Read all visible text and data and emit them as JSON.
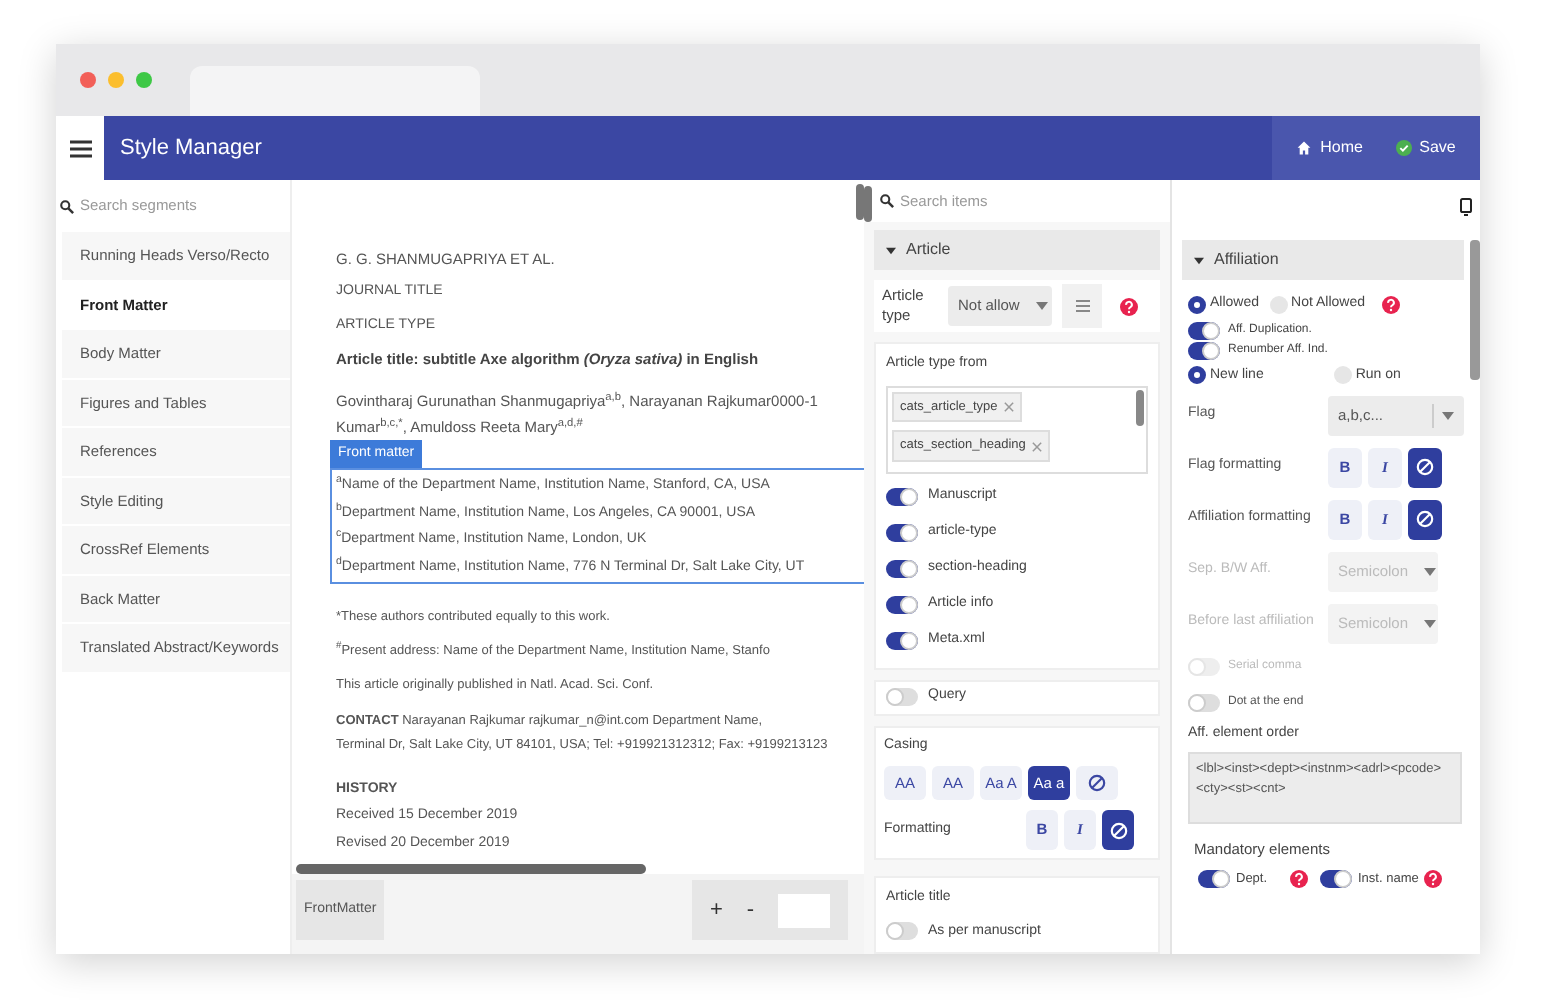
{
  "header": {
    "title": "Style Manager",
    "actions": [
      {
        "kind": "home",
        "label": "Home"
      },
      {
        "kind": "save",
        "label": "Save"
      }
    ]
  },
  "sidebar": {
    "placeholder": "Search segments",
    "items": [
      {
        "label": "Running Heads Verso/Recto",
        "selected": false
      },
      {
        "label": "Front Matter",
        "selected": true
      },
      {
        "label": "Body Matter",
        "selected": false
      },
      {
        "label": "Figures and Tables",
        "selected": false
      },
      {
        "label": "References",
        "selected": false
      },
      {
        "label": "Style Editing",
        "selected": false
      },
      {
        "label": "CrossRef Elements",
        "selected": false
      },
      {
        "label": "Back Matter",
        "selected": false
      },
      {
        "label": "Translated Abstract/Keywords",
        "selected": false
      }
    ]
  },
  "document": {
    "heads": [
      "G. G. SHANMUGAPRIYA ET AL.",
      "JOURNAL TITLE",
      "ARTICLE TYPE"
    ],
    "article_title": "Article title: subtitle Axe algorithm *(Oryza sativa)* in English",
    "authors": [
      "Govintharaj Gurunathan Shanmugapriya$^{a,b}$, Narayanan Rajkumar0000-1",
      "Kumar$^{b,c,*}$, Amuldoss Reeta Mary$^{a,d,#}$"
    ],
    "frame": {
      "label": "Front matter",
      "lines": [
        "$^{a}$Name of the Department Name, Institution Name, Stanford, CA, USA",
        "$^{b}$Department Name, Institution Name, Los Angeles, CA 90001, USA",
        "$^{c}$Department Name, Institution Name, London, UK",
        "$^{d}$Department Name, Institution Name, 776 N Terminal Dr, Salt Lake City, UT"
      ]
    },
    "notes": [
      "*These authors contributed equally to this work.",
      "$^{#}$Present address: Name of the Department Name, Institution Name, Stanfo",
      "This article originally published in Natl. Acad. Sci. Conf."
    ],
    "contact": [
      "**CONTACT** Narayanan Rajkumar rajkumar_n@int.com Department Name,",
      "Terminal Dr, Salt Lake City, UT 84101, USA; Tel: +919921312312; Fax: +9199213123"
    ],
    "history": {
      "heading": "HISTORY",
      "lines": [
        "Received 15 December 2019",
        "Revised 20 December 2019"
      ]
    },
    "bottom_bar": {
      "segment": "FrontMatter",
      "zoom_in": "+",
      "zoom_out": "-"
    }
  },
  "article_panel": {
    "placeholder": "Search items",
    "title": "Article",
    "expanded": true,
    "article_type": {
      "label": "Article type",
      "value": "Not allow"
    },
    "type_from": {
      "label": "Article type from",
      "tags": [
        "cats_article_type",
        "cats_section_heading"
      ]
    },
    "toggles": [
      {
        "label": "Manuscript",
        "on": true
      },
      {
        "label": "article-type",
        "on": true
      },
      {
        "label": "section-heading",
        "on": true
      },
      {
        "label": "Article info",
        "on": true
      },
      {
        "label": "Meta.xml",
        "on": true
      }
    ],
    "query": {
      "label": "Query",
      "on": false
    },
    "casing": {
      "label": "Casing",
      "options": [
        {
          "kind": "text",
          "label": "AA",
          "selected": false
        },
        {
          "kind": "text",
          "label": "AA",
          "selected": false
        },
        {
          "kind": "text",
          "label": "Aa A",
          "selected": false
        },
        {
          "kind": "text",
          "label": "Aa a",
          "selected": true
        },
        {
          "kind": "none",
          "selected": false
        }
      ]
    },
    "formatting": {
      "label": "Formatting",
      "options": [
        {
          "kind": "bold",
          "label": "B",
          "selected": false
        },
        {
          "kind": "italic",
          "label": "I",
          "selected": false
        },
        {
          "kind": "none",
          "selected": true
        }
      ]
    },
    "article_title": {
      "label": "Article title",
      "toggle": {
        "label": "As per manuscript",
        "on": false
      }
    }
  },
  "affiliation_panel": {
    "title": "Affiliation",
    "expanded": true,
    "allowed": [
      {
        "label": "Allowed",
        "selected": true
      },
      {
        "label": "Not Allowed",
        "selected": false
      }
    ],
    "toggles": [
      {
        "label": "Aff. Duplication.",
        "on": true
      },
      {
        "label": "Renumber Aff. Ind.",
        "on": true
      }
    ],
    "placement": [
      {
        "label": "New line",
        "selected": true
      },
      {
        "label": "Run on",
        "selected": false
      }
    ],
    "rows": [
      {
        "kind": "select",
        "label": "Flag",
        "value": "a,b,c...",
        "disabled": false
      },
      {
        "kind": "format",
        "label": "Flag formatting",
        "options": [
          {
            "kind": "bold",
            "label": "B",
            "selected": false
          },
          {
            "kind": "italic",
            "label": "I",
            "selected": false
          },
          {
            "kind": "none",
            "selected": true
          }
        ]
      },
      {
        "kind": "format",
        "label": "Affiliation formatting",
        "options": [
          {
            "kind": "bold",
            "label": "B",
            "selected": false
          },
          {
            "kind": "italic",
            "label": "I",
            "selected": false
          },
          {
            "kind": "none",
            "selected": true
          }
        ]
      },
      {
        "kind": "select",
        "label": "Sep. B/W Aff.",
        "value": "Semicolon",
        "disabled": true
      },
      {
        "kind": "select",
        "label": "Before last affiliation",
        "value": "Semicolon",
        "disabled": true
      }
    ],
    "switches": [
      {
        "label": "Serial comma",
        "on": false,
        "disabled": true
      },
      {
        "label": "Dot at the end",
        "on": false,
        "disabled": false
      }
    ],
    "element_order": {
      "label": "Aff. element order",
      "value": "<lbl><inst><dept><instnm><adrl><pcode><cty><st><cnt>"
    },
    "mandatory": {
      "label": "Mandatory elements",
      "items": [
        {
          "label": "Dept.",
          "on": true
        },
        {
          "label": "Inst. name",
          "on": true
        }
      ]
    }
  }
}
